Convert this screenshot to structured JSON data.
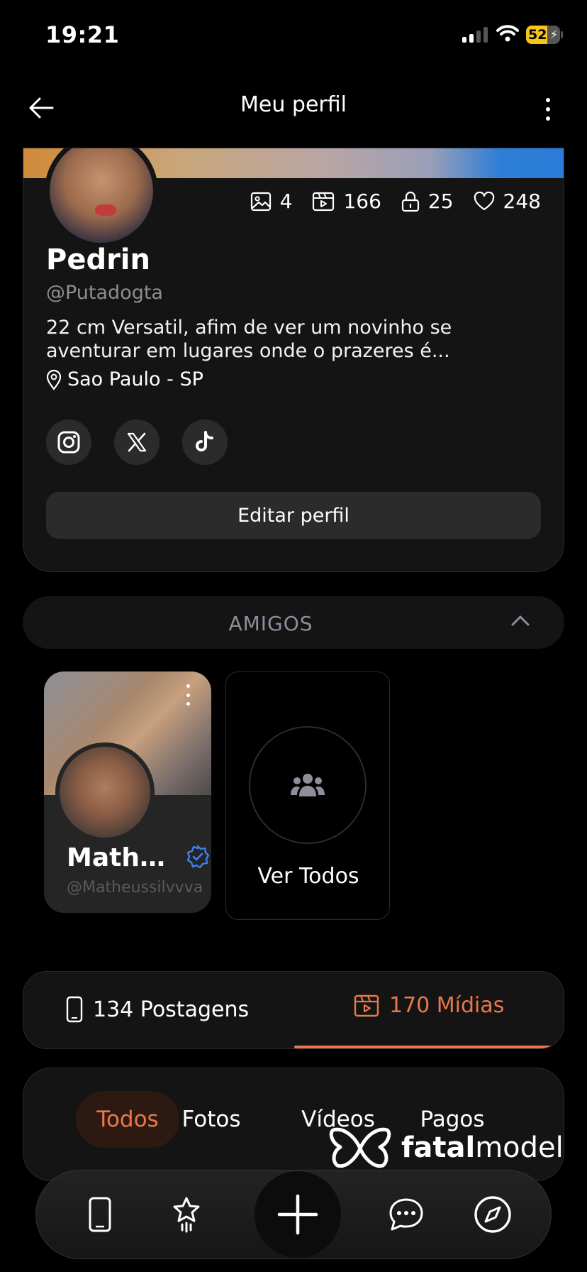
{
  "status_bar": {
    "time": "19:21",
    "battery": "52"
  },
  "header": {
    "title": "Meu perfil"
  },
  "profile": {
    "name": "Pedrin",
    "handle": "@Putadogta",
    "bio": "22 cm Versatil, afim de ver um novinho se aventurar em lugares onde o prazeres é...",
    "location": "Sao Paulo - SP",
    "stats": {
      "photos": "4",
      "videos": "166",
      "locked": "25",
      "likes": "248"
    },
    "edit_label": "Editar perfil"
  },
  "friends": {
    "title": "AMIGOS",
    "cards": [
      {
        "name": "Matheu...",
        "handle": "@Matheussilvvva"
      }
    ],
    "see_all_label": "Ver Todos"
  },
  "tabs": {
    "posts_label": "134 Postagens",
    "media_label": "170 Mídias"
  },
  "filters": [
    "Todos",
    "Fotos",
    "Vídeos",
    "Pagos"
  ],
  "watermark": {
    "brand_bold": "fatal",
    "brand_light": "model"
  },
  "colors": {
    "accent": "#e9774a",
    "background": "#000000",
    "card": "#141414",
    "verified": "#3b82f6"
  },
  "icons": {
    "stats": [
      "image-icon",
      "video-icon",
      "lock-icon",
      "heart-icon"
    ],
    "social": [
      "instagram-icon",
      "x-icon",
      "tiktok-icon"
    ],
    "nav": [
      "phone-icon",
      "star-icon",
      "plus-icon",
      "chat-icon",
      "compass-icon"
    ]
  }
}
